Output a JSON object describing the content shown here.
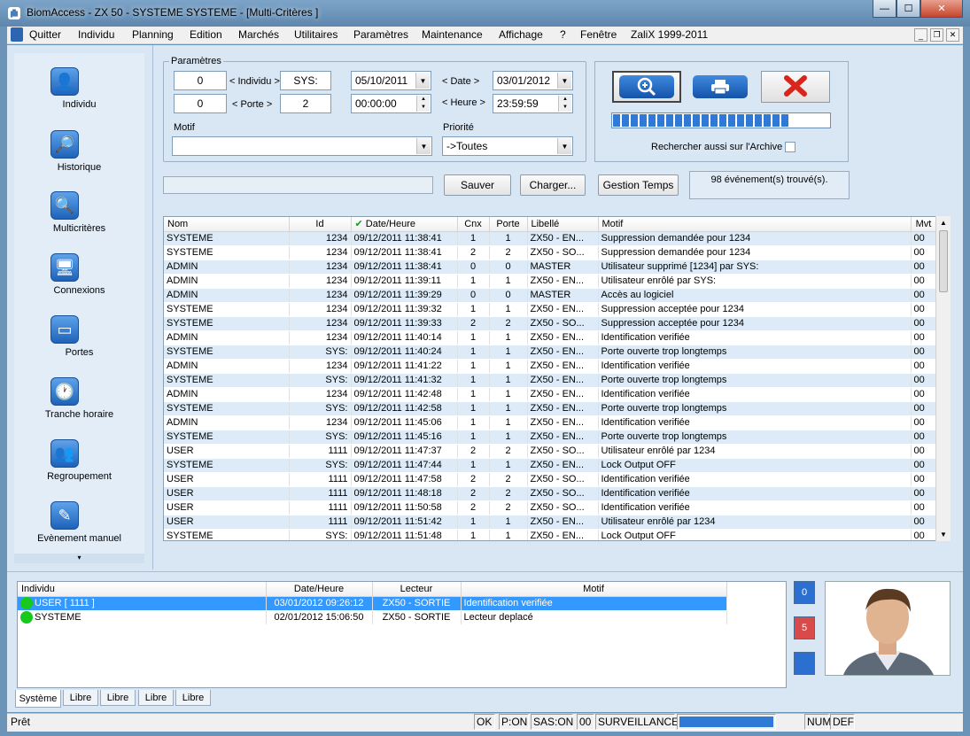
{
  "window": {
    "title": "BiomAccess - ZX 50 - SYSTEME SYSTEME - [Multi-Critères ]",
    "min": "—",
    "max": "☐",
    "close": "✕"
  },
  "menu": [
    "Quitter",
    "Individu",
    "Planning",
    "Edition",
    "Marchés",
    "Utilitaires",
    "Paramètres",
    "Maintenance",
    "Affichage",
    "?",
    "Fenêtre",
    "ZaliX 1999-2011"
  ],
  "sidebar": [
    {
      "label": "Individu",
      "icon": "person-icon"
    },
    {
      "label": "Historique",
      "icon": "history-icon"
    },
    {
      "label": "Multicritères",
      "icon": "magnifier-icon"
    },
    {
      "label": "Connexions",
      "icon": "monitor-icon"
    },
    {
      "label": "Portes",
      "icon": "door-icon"
    },
    {
      "label": "Tranche horaire",
      "icon": "clock-icon"
    },
    {
      "label": "Regroupement",
      "icon": "group-icon"
    },
    {
      "label": "Evènement manuel",
      "icon": "pencil-icon"
    }
  ],
  "params": {
    "legend": "Paramètres",
    "individu_from": "0",
    "individu_label": "< Individu >",
    "individu_to": "SYS:",
    "porte_from": "0",
    "porte_label": "< Porte >",
    "porte_to": "2",
    "date_from": "05/10/2011",
    "date_label": "< Date >",
    "date_to": "03/01/2012",
    "time_from": "00:00:00",
    "time_label": "< Heure >",
    "time_to": "23:59:59",
    "motif_label": "Motif",
    "motif_value": "",
    "priorite_label": "Priorité",
    "priorite_value": "->Toutes"
  },
  "actions": {
    "search": "search-button",
    "print": "print-button",
    "cancel": "cancel-button",
    "progress_segments": 20,
    "progress": 1.0,
    "archive_label": "Rechercher aussi sur l'Archive",
    "archive_checked": false
  },
  "buttons": {
    "save": "Sauver",
    "load": "Charger...",
    "time_mgmt": "Gestion Temps",
    "result": "98 événement(s) trouvé(s)."
  },
  "table": {
    "headers": [
      "Nom",
      "Id",
      "Date/Heure",
      "Cnx",
      "Porte",
      "Libellé",
      "Motif",
      "Mvt"
    ],
    "rows": [
      [
        "SYSTEME",
        "1234",
        "09/12/2011 11:38:41",
        "1",
        "1",
        "ZX50 - EN...",
        "Suppression demandée pour 1234",
        "00"
      ],
      [
        "SYSTEME",
        "1234",
        "09/12/2011 11:38:41",
        "2",
        "2",
        "ZX50 - SO...",
        "Suppression demandée pour 1234",
        "00"
      ],
      [
        "ADMIN",
        "1234",
        "09/12/2011 11:38:41",
        "0",
        "0",
        "MASTER",
        "Utilisateur supprimé [1234] par SYS:",
        "00"
      ],
      [
        "ADMIN",
        "1234",
        "09/12/2011 11:39:11",
        "1",
        "1",
        "ZX50 - EN...",
        "Utilisateur enrôlé par SYS:",
        "00"
      ],
      [
        "ADMIN",
        "1234",
        "09/12/2011 11:39:29",
        "0",
        "0",
        "MASTER",
        "Accès au logiciel",
        "00"
      ],
      [
        "SYSTEME",
        "1234",
        "09/12/2011 11:39:32",
        "1",
        "1",
        "ZX50 - EN...",
        "Suppression acceptée pour 1234",
        "00"
      ],
      [
        "SYSTEME",
        "1234",
        "09/12/2011 11:39:33",
        "2",
        "2",
        "ZX50 - SO...",
        "Suppression acceptée pour 1234",
        "00"
      ],
      [
        "ADMIN",
        "1234",
        "09/12/2011 11:40:14",
        "1",
        "1",
        "ZX50 - EN...",
        "Identification verifiée",
        "00"
      ],
      [
        "SYSTEME",
        "SYS:",
        "09/12/2011 11:40:24",
        "1",
        "1",
        "ZX50 - EN...",
        "Porte ouverte trop longtemps",
        "00"
      ],
      [
        "ADMIN",
        "1234",
        "09/12/2011 11:41:22",
        "1",
        "1",
        "ZX50 - EN...",
        "Identification verifiée",
        "00"
      ],
      [
        "SYSTEME",
        "SYS:",
        "09/12/2011 11:41:32",
        "1",
        "1",
        "ZX50 - EN...",
        "Porte ouverte trop longtemps",
        "00"
      ],
      [
        "ADMIN",
        "1234",
        "09/12/2011 11:42:48",
        "1",
        "1",
        "ZX50 - EN...",
        "Identification verifiée",
        "00"
      ],
      [
        "SYSTEME",
        "SYS:",
        "09/12/2011 11:42:58",
        "1",
        "1",
        "ZX50 - EN...",
        "Porte ouverte trop longtemps",
        "00"
      ],
      [
        "ADMIN",
        "1234",
        "09/12/2011 11:45:06",
        "1",
        "1",
        "ZX50 - EN...",
        "Identification verifiée",
        "00"
      ],
      [
        "SYSTEME",
        "SYS:",
        "09/12/2011 11:45:16",
        "1",
        "1",
        "ZX50 - EN...",
        "Porte ouverte trop longtemps",
        "00"
      ],
      [
        "USER",
        "1111",
        "09/12/2011 11:47:37",
        "2",
        "2",
        "ZX50 - SO...",
        "Utilisateur enrôlé par 1234",
        "00"
      ],
      [
        "SYSTEME",
        "SYS:",
        "09/12/2011 11:47:44",
        "1",
        "1",
        "ZX50 - EN...",
        "Lock Output OFF",
        "00"
      ],
      [
        "USER",
        "1111",
        "09/12/2011 11:47:58",
        "2",
        "2",
        "ZX50 - SO...",
        "Identification verifiée",
        "00"
      ],
      [
        "USER",
        "1111",
        "09/12/2011 11:48:18",
        "2",
        "2",
        "ZX50 - SO...",
        "Identification verifiée",
        "00"
      ],
      [
        "USER",
        "1111",
        "09/12/2011 11:50:58",
        "2",
        "2",
        "ZX50 - SO...",
        "Identification verifiée",
        "00"
      ],
      [
        "USER",
        "1111",
        "09/12/2011 11:51:42",
        "1",
        "1",
        "ZX50 - EN...",
        "Utilisateur enrôlé par 1234",
        "00"
      ],
      [
        "SYSTEME",
        "SYS:",
        "09/12/2011 11:51:48",
        "1",
        "1",
        "ZX50 - EN...",
        "Lock Output OFF",
        "00"
      ]
    ]
  },
  "bottom_table": {
    "headers": [
      "Individu",
      "Date/Heure",
      "Lecteur",
      "Motif"
    ],
    "rows": [
      [
        "USER   [ 1111 ]",
        "03/01/2012 09:26:12",
        "ZX50 - SORTIE",
        "Identification verifiée"
      ],
      [
        "SYSTEME",
        "02/01/2012 15:06:50",
        "ZX50 - SORTIE",
        "Lecteur deplacé"
      ]
    ]
  },
  "counters": {
    "blue": "0",
    "red": "5",
    "blank": ""
  },
  "tabs": [
    "Système",
    "Libre",
    "Libre",
    "Libre",
    "Libre"
  ],
  "status": {
    "text": "Prêt",
    "ok": "OK",
    "pon": "P:ON",
    "sas": "SAS:ON",
    "zero": "00",
    "surv": "SURVEILLANCE",
    "num": "NUM",
    "def": "DEF"
  },
  "colors": {
    "accent": "#2e7ad6",
    "selected_row": "#3399ff",
    "alt_row": "#dcebf7"
  }
}
